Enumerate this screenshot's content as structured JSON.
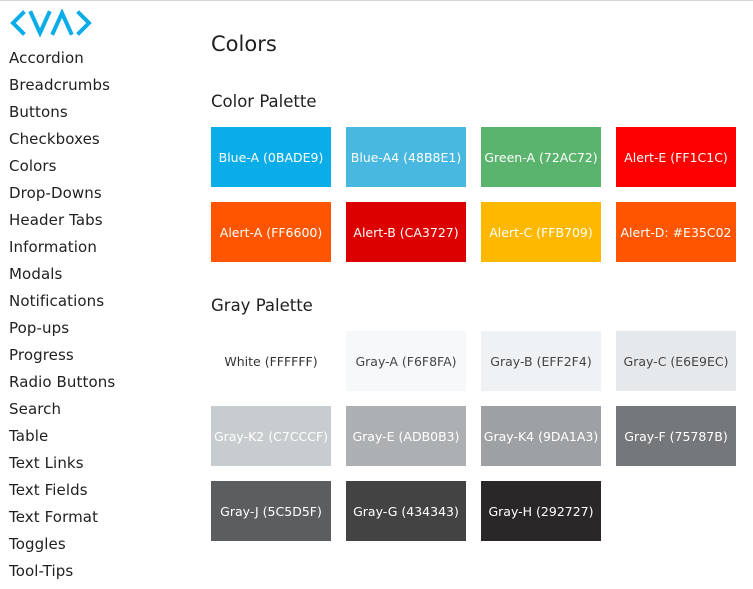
{
  "logo": {
    "name": "VA logo",
    "color": "#0BADE9"
  },
  "sidebar": {
    "items": [
      {
        "label": "Accordion"
      },
      {
        "label": "Breadcrumbs"
      },
      {
        "label": "Buttons"
      },
      {
        "label": "Checkboxes"
      },
      {
        "label": "Colors"
      },
      {
        "label": "Drop-Downs"
      },
      {
        "label": "Header Tabs"
      },
      {
        "label": "Information"
      },
      {
        "label": "Modals"
      },
      {
        "label": "Notifications"
      },
      {
        "label": "Pop-ups"
      },
      {
        "label": "Progress"
      },
      {
        "label": "Radio Buttons"
      },
      {
        "label": "Search"
      },
      {
        "label": "Table"
      },
      {
        "label": "Text Links"
      },
      {
        "label": "Text Fields"
      },
      {
        "label": "Text Format"
      },
      {
        "label": "Toggles"
      },
      {
        "label": "Tool-Tips"
      }
    ]
  },
  "main": {
    "title": "Colors",
    "color_palette": {
      "heading": "Color Palette",
      "swatches": [
        {
          "label": "Blue-A (0BADE9)",
          "color": "#0BADE9",
          "text_color": "#ffffff"
        },
        {
          "label": "Blue-A4 (48B8E1)",
          "color": "#48B8E1",
          "text_color": "#ffffff"
        },
        {
          "label": "Green-A (72AC72)",
          "color": "#5BB46E",
          "text_color": "#ffffff"
        },
        {
          "label": "Alert-E (FF1C1C)",
          "color": "#FF0000",
          "text_color": "#ffffff"
        },
        {
          "label": "Alert-A (FF6600)",
          "color": "#FF5500",
          "text_color": "#ffffff"
        },
        {
          "label": "Alert-B (CA3727)",
          "color": "#DD0000",
          "text_color": "#ffffff"
        },
        {
          "label": "Alert-C (FFB709)",
          "color": "#FFB800",
          "text_color": "#ffffff"
        },
        {
          "label": "Alert-D: #E35C02",
          "color": "#FF5500",
          "text_color": "#ffffff"
        }
      ]
    },
    "gray_palette": {
      "heading": "Gray Palette",
      "swatches": [
        {
          "label": "White (FFFFFF)",
          "color": "#FFFFFF",
          "text_color": "#333333"
        },
        {
          "label": "Gray-A (F6F8FA)",
          "color": "#F6F8FA",
          "text_color": "#444444"
        },
        {
          "label": "Gray-B (EFF2F4)",
          "color": "#EFF2F4",
          "text_color": "#444444"
        },
        {
          "label": "Gray-C (E6E9EC)",
          "color": "#E6E9EC",
          "text_color": "#444444"
        },
        {
          "label": "Gray-K2 (C7CCCF)",
          "color": "#C7CCCF",
          "text_color": "#ffffff"
        },
        {
          "label": "Gray-E (ADB0B3)",
          "color": "#ADB0B3",
          "text_color": "#ffffff"
        },
        {
          "label": "Gray-K4 (9DA1A3)",
          "color": "#9DA1A3",
          "text_color": "#ffffff"
        },
        {
          "label": "Gray-F (75787B)",
          "color": "#75787B",
          "text_color": "#ffffff"
        },
        {
          "label": "Gray-J (5C5D5F)",
          "color": "#5C5D5F",
          "text_color": "#ffffff"
        },
        {
          "label": "Gray-G (434343)",
          "color": "#434343",
          "text_color": "#ffffff"
        },
        {
          "label": "Gray-H (292727)",
          "color": "#292727",
          "text_color": "#ffffff"
        }
      ]
    }
  }
}
